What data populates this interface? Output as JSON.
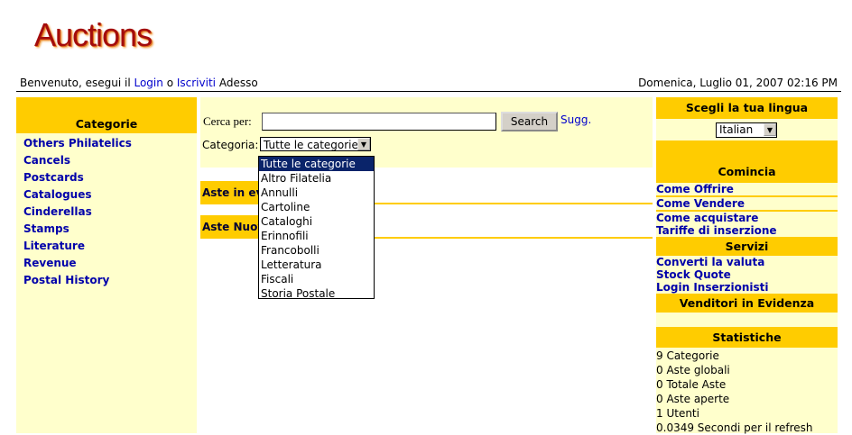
{
  "logo": "Auctions",
  "topbar": {
    "welcome": "Benvenuto, esegui il",
    "login": "Login",
    "o": "o",
    "register": "Iscriviti",
    "adesso": "Adesso",
    "datetime": "Domenica, Luglio 01, 2007 02:16 PM"
  },
  "sidebar": {
    "title": "Categorie",
    "items": [
      "Others Philatelics",
      "Cancels",
      "Postcards",
      "Catalogues",
      "Cinderellas",
      "Stamps",
      "Literature",
      "Revenue",
      "Postal History"
    ]
  },
  "search": {
    "label": "Cerca per:",
    "value": "",
    "button": "Search",
    "sugg": "Sugg.",
    "category_label": "Categoria:",
    "category_selected": "Tutte le categorie",
    "options": [
      "Tutte le categorie",
      "Altro Filatelia",
      "Annulli",
      "Cartoline",
      "Cataloghi",
      "Erinnofili",
      "Francobolli",
      "Letteratura",
      "Fiscali",
      "Storia Postale"
    ]
  },
  "bands": {
    "featured": "Aste in ev",
    "new": "Aste Nuov"
  },
  "right": {
    "lang_title": "Scegli la tua lingua",
    "lang_selected": "Italian",
    "start_title": "Comincia",
    "start_links": [
      "Come Offrire",
      "Come Vendere",
      "Come acquistare",
      "Tariffe di inserzione"
    ],
    "services_title": "Servizi",
    "services_links": [
      "Converti la valuta",
      "Stock Quote",
      "Login Inserzionisti"
    ],
    "sellers_title": "Venditori in Evidenza",
    "stats_title": "Statistiche",
    "stats": [
      "9 Categorie",
      "0 Aste globali",
      "0 Totale Aste",
      "0 Aste aperte",
      "1 Utenti",
      "0.0349 Secondi per il refresh"
    ]
  }
}
